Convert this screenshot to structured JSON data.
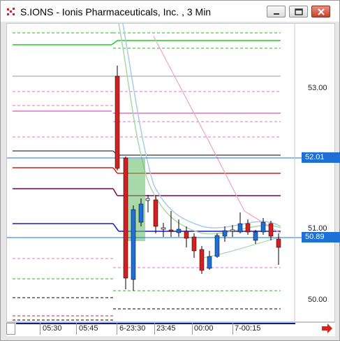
{
  "window": {
    "title": "S.IONS - Ionis Pharmaceuticals, Inc. , 3 Min"
  },
  "price_axis": {
    "labels": [
      "53.00",
      "52.01",
      "51.00",
      "50.89",
      "50.00"
    ],
    "tags": [
      "52.01",
      "50.89"
    ]
  },
  "time_axis": {
    "labels": [
      "05:30",
      "05:45",
      "6-23:30",
      "23:45",
      "00:00",
      "7-00:15"
    ]
  },
  "icons": {
    "app": "chart-app-icon",
    "minimize": "minimize-icon",
    "restore": "restore-icon",
    "close": "close-icon",
    "next": "red-right-arrow-icon"
  },
  "colors": {
    "blue_tag": "#1e6fd6",
    "up_candle": "#1e6fd6",
    "down_candle": "#d42020",
    "shade": "#6ec06e"
  }
}
